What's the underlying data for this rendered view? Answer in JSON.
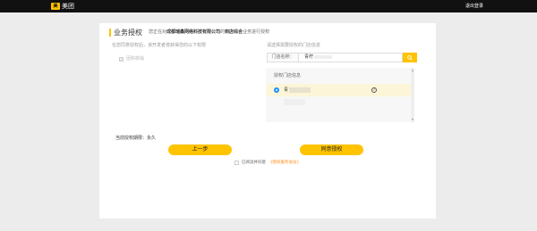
{
  "header": {
    "logo_mark": "美",
    "logo_text": "美团",
    "logout_label": "退出登录"
  },
  "card": {
    "title": "业务授权",
    "subtitle_prefix": "您正在对",
    "company": "成都瑞鑫网络科技有限公司",
    "subtitle_mid": "的",
    "business": "到店综合",
    "subtitle_suffix": "业务进行授权"
  },
  "permissions": {
    "description": "在您同意授权后，该开发者将获得您的以下权限",
    "items": [
      {
        "label": "团购核销",
        "checked": true
      }
    ]
  },
  "stores": {
    "description": "请选择需要授权的门店信息",
    "search_label": "门店名称：",
    "search_value": "青柠",
    "search_icon": "search-icon",
    "header": "授权门店信息",
    "selected_prefix": "青",
    "colors": {
      "accent": "#ffc300",
      "selected_row": "#fdf5d7",
      "radio": "#1890ff"
    }
  },
  "term": {
    "text": "当前授权期限：永久"
  },
  "actions": {
    "prev_label": "上一步",
    "agree_label": "同意授权"
  },
  "agreement": {
    "text": "已阅读并同意",
    "link": "《授权服务协议》"
  }
}
